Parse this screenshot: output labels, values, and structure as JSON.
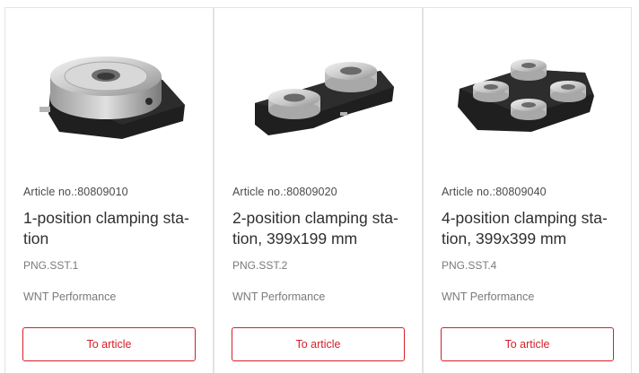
{
  "products": [
    {
      "article_no": "Article no.:80809010",
      "title": "1-position clamping sta-tion",
      "code": "PNG.SST.1",
      "series": "WNT Performance",
      "button_label": "To article"
    },
    {
      "article_no": "Article no.:80809020",
      "title": "2-position clamping sta-tion, 399x199 mm",
      "code": "PNG.SST.2",
      "series": "WNT Performance",
      "button_label": "To article"
    },
    {
      "article_no": "Article no.:80809040",
      "title": "4-position clamping sta-tion, 399x399 mm",
      "code": "PNG.SST.4",
      "series": "WNT Performance",
      "button_label": "To article"
    }
  ],
  "colors": {
    "accent": "#d51f2a",
    "base_black": "#1e1e1e",
    "steel": "#c8c8c8"
  }
}
